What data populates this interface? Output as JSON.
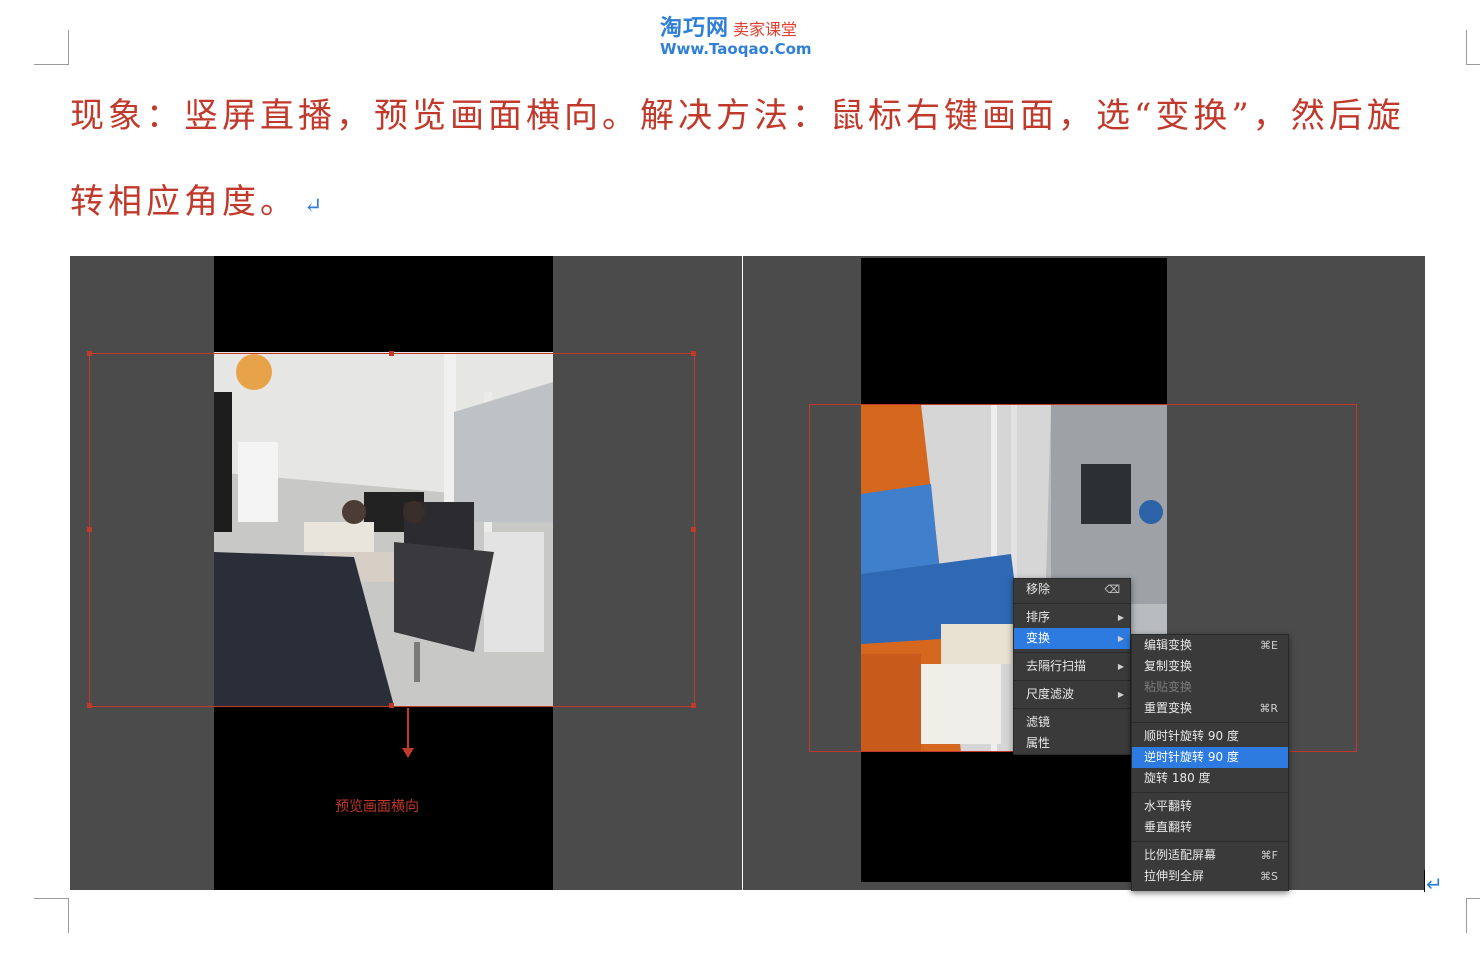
{
  "header": {
    "logo_main": "淘巧网",
    "logo_sub": "卖家课堂",
    "logo_url": "Www.Taoqao.Com"
  },
  "paragraph": {
    "line1": "现象：竖屏直播，预览画面横向。解决方法：鼠标右键画面，选“变换”，然后旋",
    "line2": "转相应角度。",
    "paragraph_mark": "↵"
  },
  "left_panel": {
    "annotation": "预览画面横向"
  },
  "context_menu": {
    "items": [
      {
        "label": "移除",
        "shortcut": "⌫"
      },
      {
        "label": "排序",
        "submenu": true
      },
      {
        "label": "变换",
        "submenu": true,
        "active": true
      },
      {
        "label": "去隔行扫描",
        "submenu": true
      },
      {
        "label": "尺度滤波",
        "submenu": true
      },
      {
        "label": "滤镜"
      },
      {
        "label": "属性"
      }
    ]
  },
  "submenu": {
    "items": [
      {
        "label": "编辑变换",
        "shortcut": "⌘E"
      },
      {
        "label": "复制变换"
      },
      {
        "label": "粘贴变换",
        "disabled": true
      },
      {
        "label": "重置变换",
        "shortcut": "⌘R"
      },
      {
        "label": "顺时针旋转 90 度"
      },
      {
        "label": "逆时针旋转 90 度",
        "active": true
      },
      {
        "label": "旋转 180 度"
      },
      {
        "label": "水平翻转"
      },
      {
        "label": "垂直翻转"
      },
      {
        "label": "比例适配屏幕",
        "shortcut": "⌘F"
      },
      {
        "label": "拉伸到全屏",
        "shortcut": "⌘S"
      }
    ]
  },
  "colors": {
    "accent_text": "#c0392b",
    "logo_blue": "#2f7fd6",
    "panel_bg": "#4b4b4b",
    "menu_highlight": "#2d7be0"
  },
  "end_mark": "↵"
}
